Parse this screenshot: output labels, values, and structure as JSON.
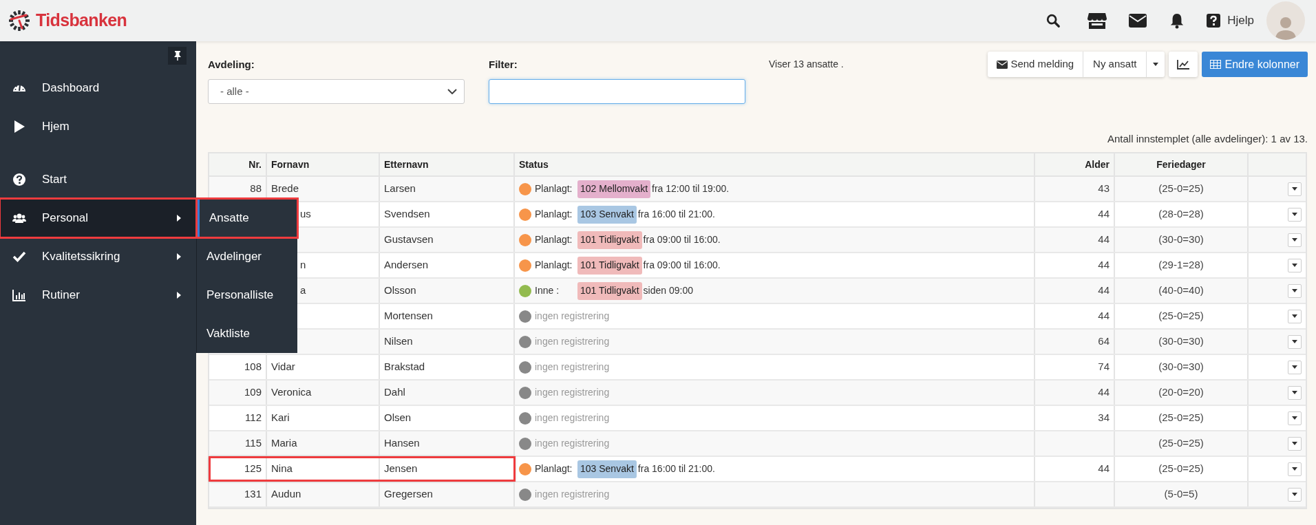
{
  "header": {
    "logo_text": "Tidsbanken",
    "help_label": "Hjelp"
  },
  "sidebar": {
    "items": [
      {
        "label": "Dashboard",
        "has_submenu": false,
        "selected": false,
        "highlighted": false
      },
      {
        "label": "Hjem",
        "has_submenu": false,
        "selected": false,
        "highlighted": false
      },
      {
        "label": "Start",
        "has_submenu": false,
        "selected": false,
        "highlighted": false
      },
      {
        "label": "Personal",
        "has_submenu": true,
        "selected": true,
        "highlighted": true
      },
      {
        "label": "Kvalitetssikring",
        "has_submenu": true,
        "selected": false,
        "highlighted": false
      },
      {
        "label": "Rutiner",
        "has_submenu": true,
        "selected": false,
        "highlighted": false
      }
    ]
  },
  "submenu": {
    "items": [
      {
        "label": "Ansatte",
        "selected": true,
        "highlighted": true
      },
      {
        "label": "Avdelinger",
        "selected": false,
        "highlighted": false
      },
      {
        "label": "Personalliste",
        "selected": false,
        "highlighted": false
      },
      {
        "label": "Vaktliste",
        "selected": false,
        "highlighted": false
      }
    ]
  },
  "filters": {
    "department_label": "Avdeling:",
    "department_value": "- alle -",
    "filter_label": "Filter:",
    "count_text": "Viser 13 ansatte ."
  },
  "toolbar": {
    "send_message": "Send melding",
    "new_employee": "Ny ansatt",
    "change_columns": "Endre kolonner"
  },
  "summary": "Antall innstemplet (alle avdelinger): 1 av 13.",
  "table": {
    "columns": [
      "Nr.",
      "Fornavn",
      "Etternavn",
      "Status",
      "Alder",
      "Feriedager"
    ],
    "rows": [
      {
        "nr": "88",
        "fornavn": "Brede",
        "etternavn": "Larsen",
        "status": {
          "kind": "planned",
          "color": "#f7954a",
          "label": "Planlagt:",
          "shift": {
            "text": "102 Mellomvakt",
            "color": "#e4b0cc"
          },
          "detail": "fra 12:00 til 19:00."
        },
        "alder": "43",
        "feriedager": "(25-0=25)",
        "highlighted": false
      },
      {
        "fornavn": "us",
        "etternavn": "Svendsen",
        "status": {
          "kind": "planned",
          "color": "#f7954a",
          "label": "Planlagt:",
          "shift": {
            "text": "103 Senvakt",
            "color": "#a9c7e3"
          },
          "detail": "fra 16:00 til 21:00."
        },
        "alder": "44",
        "feriedager": "(28-0=28)",
        "highlighted": false
      },
      {
        "etternavn": "Gustavsen",
        "status": {
          "kind": "planned",
          "color": "#f7954a",
          "label": "Planlagt:",
          "shift": {
            "text": "101 Tidligvakt",
            "color": "#f0baba"
          },
          "detail": "fra 09:00 til 16:00."
        },
        "alder": "44",
        "feriedager": "(30-0=30)",
        "highlighted": false
      },
      {
        "fornavn": "n",
        "etternavn": "Andersen",
        "status": {
          "kind": "planned",
          "color": "#f7954a",
          "label": "Planlagt:",
          "shift": {
            "text": "101 Tidligvakt",
            "color": "#f0baba"
          },
          "detail": "fra 09:00 til 16:00."
        },
        "alder": "44",
        "feriedager": "(29-1=28)",
        "highlighted": false
      },
      {
        "fornavn": "a",
        "etternavn": "Olsson",
        "status": {
          "kind": "in",
          "color": "#93bb4f",
          "label": "Inne :",
          "shift": {
            "text": "101 Tidligvakt",
            "color": "#f0baba"
          },
          "detail": "siden 09:00"
        },
        "alder": "44",
        "feriedager": "(40-0=40)",
        "highlighted": false
      },
      {
        "etternavn": "Mortensen",
        "status": {
          "kind": "none",
          "color": "#888888",
          "label": "ingen registrering"
        },
        "alder": "44",
        "feriedager": "(25-0=25)",
        "highlighted": false
      },
      {
        "etternavn": "Nilsen",
        "status": {
          "kind": "none",
          "color": "#888888",
          "label": "ingen registrering"
        },
        "alder": "64",
        "feriedager": "(30-0=30)",
        "highlighted": false
      },
      {
        "nr": "108",
        "fornavn": "Vidar",
        "etternavn": "Brakstad",
        "status": {
          "kind": "none",
          "color": "#888888",
          "label": "ingen registrering"
        },
        "alder": "74",
        "feriedager": "(30-0=30)",
        "highlighted": false
      },
      {
        "nr": "109",
        "fornavn": "Veronica",
        "etternavn": "Dahl",
        "status": {
          "kind": "none",
          "color": "#888888",
          "label": "ingen registrering"
        },
        "alder": "44",
        "feriedager": "(20-0=20)",
        "highlighted": false
      },
      {
        "nr": "112",
        "fornavn": "Kari",
        "etternavn": "Olsen",
        "status": {
          "kind": "none",
          "color": "#888888",
          "label": "ingen registrering"
        },
        "alder": "34",
        "feriedager": "(25-0=25)",
        "highlighted": false
      },
      {
        "nr": "115",
        "fornavn": "Maria",
        "etternavn": "Hansen",
        "status": {
          "kind": "none",
          "color": "#888888",
          "label": "ingen registrering"
        },
        "feriedager": "(25-0=25)",
        "highlighted": false
      },
      {
        "nr": "125",
        "fornavn": "Nina",
        "etternavn": "Jensen",
        "status": {
          "kind": "planned",
          "color": "#f7954a",
          "label": "Planlagt:",
          "shift": {
            "text": "103 Senvakt",
            "color": "#a9c7e3"
          },
          "detail": "fra 16:00 til 21:00."
        },
        "alder": "44",
        "feriedager": "(25-0=25)",
        "highlighted": true
      },
      {
        "nr": "131",
        "fornavn": "Audun",
        "etternavn": "Gregersen",
        "status": {
          "kind": "none",
          "color": "#888888",
          "label": "ingen registrering"
        },
        "feriedager": "(5-0=5)",
        "highlighted": false
      }
    ]
  }
}
